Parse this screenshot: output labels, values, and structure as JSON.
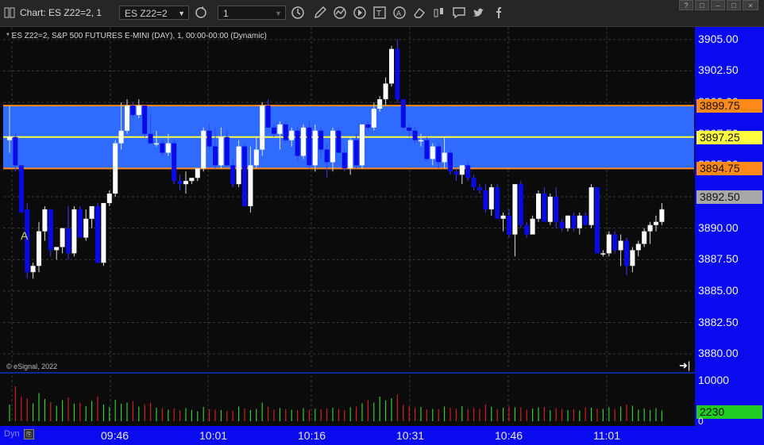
{
  "window": {
    "title": "Chart: ES Z22=2, 1",
    "symbol": "ES Z22=2",
    "interval": "1",
    "controls": [
      "?",
      "□",
      "–",
      "□",
      "×"
    ]
  },
  "toolbar_icons": [
    "refresh-icon",
    "clock-icon",
    "pencil-icon",
    "chart-icon",
    "play-icon",
    "text-icon",
    "alert-icon",
    "eraser-icon",
    "bars-icon",
    "chat-icon",
    "twitter-icon",
    "facebook-icon"
  ],
  "chart": {
    "info_line": "* ES Z22=2, S&P 500 FUTURES E-MINI (DAY), 1, 00:00-00:00 (Dynamic)",
    "copyright": "© eSignal, 2022",
    "marker_text": "A",
    "dyn_label": "Dyn",
    "up_color": "#ffffff",
    "down_color": "#0a0ae8",
    "band_color": "#2f6bff",
    "band_line_color": "#ff8a1a",
    "mid_line_color": "#ffff40"
  },
  "price_axis": {
    "labels": [
      "3905.00",
      "3902.50",
      "3900.00",
      "3897.50",
      "3895.00",
      "3892.50",
      "3890.00",
      "3887.50",
      "3885.00",
      "3882.50",
      "3880.00"
    ],
    "tags": [
      {
        "text": "3899.75",
        "value": 3899.75,
        "bg": "#ff8a1a"
      },
      {
        "text": "3897.25",
        "value": 3897.25,
        "bg": "#ffff40"
      },
      {
        "text": "3894.75",
        "value": 3894.75,
        "bg": "#ff8a1a"
      },
      {
        "text": "3892.50",
        "value": 3892.5,
        "bg": "#a8a8a8"
      }
    ]
  },
  "volume_axis": {
    "max_label": "10000",
    "min_label": "0",
    "last_tag": "2230",
    "last_tag_bg": "#22cc22"
  },
  "time_axis": {
    "labels": [
      "09:46",
      "10:01",
      "10:16",
      "10:31",
      "10:46",
      "11:01"
    ]
  },
  "chart_data": {
    "type": "candlestick",
    "ylim": [
      3878.75,
      3906.0
    ],
    "band": {
      "upper": 3899.75,
      "mid": 3897.25,
      "lower": 3894.75
    },
    "candles": [
      [
        3897.0,
        3899.75,
        3896.0,
        3897.25
      ],
      [
        3897.25,
        3897.5,
        3894.5,
        3895.0
      ],
      [
        3895.0,
        3895.0,
        3891.25,
        3891.25
      ],
      [
        3891.5,
        3892.0,
        3886.0,
        3886.5
      ],
      [
        3886.5,
        3887.25,
        3886.0,
        3887.0
      ],
      [
        3887.0,
        3890.5,
        3886.5,
        3889.75
      ],
      [
        3889.75,
        3891.75,
        3889.0,
        3891.5
      ],
      [
        3891.5,
        3891.5,
        3887.75,
        3888.25
      ],
      [
        3888.25,
        3888.5,
        3887.5,
        3888.5
      ],
      [
        3888.5,
        3890.0,
        3888.0,
        3890.0
      ],
      [
        3890.0,
        3891.75,
        3887.5,
        3888.0
      ],
      [
        3888.0,
        3891.75,
        3887.75,
        3891.5
      ],
      [
        3891.5,
        3891.75,
        3889.25,
        3889.25
      ],
      [
        3889.25,
        3891.5,
        3889.0,
        3890.75
      ],
      [
        3890.75,
        3891.5,
        3890.0,
        3891.75
      ],
      [
        3891.75,
        3892.0,
        3887.25,
        3887.25
      ],
      [
        3887.25,
        3892.0,
        3887.0,
        3892.0
      ],
      [
        3892.0,
        3893.0,
        3891.75,
        3892.75
      ],
      [
        3892.75,
        3897.0,
        3892.5,
        3896.75
      ],
      [
        3896.75,
        3900.0,
        3896.25,
        3897.75
      ],
      [
        3897.75,
        3900.25,
        3897.5,
        3899.75
      ],
      [
        3899.75,
        3900.0,
        3898.75,
        3899.0
      ],
      [
        3899.0,
        3900.25,
        3898.75,
        3899.75
      ],
      [
        3899.75,
        3899.75,
        3897.25,
        3897.5
      ],
      [
        3897.5,
        3899.0,
        3896.75,
        3896.75
      ],
      [
        3896.75,
        3897.75,
        3896.5,
        3896.75
      ],
      [
        3896.75,
        3897.0,
        3895.75,
        3896.0
      ],
      [
        3896.0,
        3897.5,
        3895.75,
        3896.75
      ],
      [
        3896.75,
        3897.0,
        3893.5,
        3893.75
      ],
      [
        3893.75,
        3894.25,
        3893.0,
        3893.5
      ],
      [
        3893.5,
        3894.5,
        3892.75,
        3893.75
      ],
      [
        3893.75,
        3894.0,
        3893.5,
        3894.0
      ],
      [
        3894.0,
        3894.75,
        3893.75,
        3894.75
      ],
      [
        3894.75,
        3898.0,
        3894.5,
        3897.75
      ],
      [
        3897.75,
        3898.25,
        3896.25,
        3896.5
      ],
      [
        3896.5,
        3898.0,
        3894.75,
        3895.0
      ],
      [
        3895.0,
        3898.0,
        3894.75,
        3897.25
      ],
      [
        3897.25,
        3897.75,
        3895.0,
        3895.0
      ],
      [
        3895.0,
        3895.5,
        3893.25,
        3893.5
      ],
      [
        3893.5,
        3897.0,
        3893.25,
        3896.5
      ],
      [
        3896.5,
        3896.75,
        3891.75,
        3891.75
      ],
      [
        3891.75,
        3896.5,
        3891.25,
        3895.0
      ],
      [
        3895.0,
        3897.25,
        3894.75,
        3896.25
      ],
      [
        3896.25,
        3900.0,
        3895.75,
        3899.75
      ],
      [
        3899.75,
        3900.25,
        3898.0,
        3898.0
      ],
      [
        3898.0,
        3898.25,
        3897.25,
        3897.5
      ],
      [
        3897.5,
        3898.5,
        3896.25,
        3898.25
      ],
      [
        3898.25,
        3898.5,
        3896.75,
        3897.0
      ],
      [
        3897.0,
        3898.0,
        3896.5,
        3897.75
      ],
      [
        3897.75,
        3898.0,
        3895.25,
        3895.75
      ],
      [
        3895.75,
        3898.25,
        3895.5,
        3898.0
      ],
      [
        3898.0,
        3898.5,
        3894.75,
        3895.0
      ],
      [
        3895.0,
        3898.25,
        3894.5,
        3897.75
      ],
      [
        3897.75,
        3898.0,
        3895.5,
        3896.25
      ],
      [
        3896.25,
        3896.75,
        3894.0,
        3895.25
      ],
      [
        3895.25,
        3898.0,
        3894.5,
        3897.75
      ],
      [
        3897.75,
        3898.0,
        3896.0,
        3896.0
      ],
      [
        3896.0,
        3896.25,
        3894.5,
        3894.75
      ],
      [
        3894.75,
        3897.25,
        3894.25,
        3897.0
      ],
      [
        3897.0,
        3897.5,
        3894.75,
        3895.0
      ],
      [
        3895.0,
        3898.25,
        3894.75,
        3898.25
      ],
      [
        3898.25,
        3898.5,
        3897.75,
        3898.0
      ],
      [
        3898.0,
        3900.0,
        3897.75,
        3899.5
      ],
      [
        3899.5,
        3900.5,
        3899.25,
        3900.25
      ],
      [
        3900.25,
        3902.0,
        3899.75,
        3901.5
      ],
      [
        3901.5,
        3904.5,
        3901.25,
        3904.25
      ],
      [
        3904.25,
        3905.0,
        3900.0,
        3900.25
      ],
      [
        3900.25,
        3900.25,
        3897.75,
        3898.0
      ],
      [
        3898.0,
        3898.25,
        3897.25,
        3897.75
      ],
      [
        3897.75,
        3898.0,
        3896.75,
        3897.0
      ],
      [
        3897.0,
        3897.5,
        3896.5,
        3897.0
      ],
      [
        3897.0,
        3897.25,
        3895.25,
        3895.5
      ],
      [
        3895.5,
        3896.75,
        3895.0,
        3896.5
      ],
      [
        3896.5,
        3896.75,
        3894.75,
        3895.25
      ],
      [
        3895.25,
        3897.25,
        3894.75,
        3896.0
      ],
      [
        3896.0,
        3896.25,
        3894.25,
        3894.5
      ],
      [
        3894.5,
        3894.75,
        3893.75,
        3894.25
      ],
      [
        3894.25,
        3895.0,
        3893.5,
        3895.0
      ],
      [
        3895.0,
        3895.25,
        3893.75,
        3894.0
      ],
      [
        3894.0,
        3894.25,
        3893.0,
        3893.25
      ],
      [
        3893.25,
        3893.5,
        3892.75,
        3893.0
      ],
      [
        3893.0,
        3893.5,
        3891.25,
        3891.5
      ],
      [
        3891.5,
        3893.5,
        3891.0,
        3893.25
      ],
      [
        3893.25,
        3893.5,
        3890.75,
        3890.75
      ],
      [
        3890.75,
        3891.25,
        3889.75,
        3891.0
      ],
      [
        3891.0,
        3891.5,
        3889.25,
        3889.5
      ],
      [
        3889.5,
        3893.5,
        3887.75,
        3893.5
      ],
      [
        3893.5,
        3893.75,
        3890.0,
        3890.25
      ],
      [
        3890.25,
        3890.5,
        3889.25,
        3889.5
      ],
      [
        3889.5,
        3891.0,
        3889.5,
        3890.75
      ],
      [
        3890.75,
        3893.0,
        3890.5,
        3892.75
      ],
      [
        3892.75,
        3893.25,
        3890.5,
        3890.5
      ],
      [
        3890.5,
        3892.75,
        3890.25,
        3892.5
      ],
      [
        3892.5,
        3893.25,
        3890.0,
        3890.5
      ],
      [
        3890.5,
        3890.75,
        3889.75,
        3890.0
      ],
      [
        3890.0,
        3891.0,
        3889.75,
        3891.0
      ],
      [
        3891.0,
        3891.25,
        3889.75,
        3890.0
      ],
      [
        3890.0,
        3891.25,
        3889.5,
        3891.0
      ],
      [
        3891.0,
        3891.25,
        3890.25,
        3890.25
      ],
      [
        3890.25,
        3893.5,
        3890.0,
        3893.25
      ],
      [
        3893.25,
        3893.25,
        3888.0,
        3888.0
      ],
      [
        3888.0,
        3888.25,
        3887.75,
        3888.0
      ],
      [
        3888.0,
        3889.75,
        3887.75,
        3889.5
      ],
      [
        3889.5,
        3889.75,
        3888.0,
        3888.25
      ],
      [
        3888.25,
        3889.5,
        3887.0,
        3889.0
      ],
      [
        3889.0,
        3889.25,
        3886.25,
        3887.0
      ],
      [
        3887.0,
        3888.5,
        3886.5,
        3888.25
      ],
      [
        3888.25,
        3889.0,
        3887.75,
        3888.75
      ],
      [
        3888.75,
        3890.0,
        3888.5,
        3889.75
      ],
      [
        3889.75,
        3890.5,
        3888.75,
        3890.25
      ],
      [
        3890.25,
        3891.0,
        3889.75,
        3890.5
      ],
      [
        3890.5,
        3892.0,
        3890.25,
        3891.5
      ]
    ],
    "volume_max": 10000,
    "volumes": [
      4200,
      8800,
      6200,
      5700,
      4500,
      7100,
      5600,
      4800,
      3900,
      5300,
      6000,
      4400,
      4700,
      3800,
      5100,
      6300,
      4200,
      3600,
      5400,
      4400,
      4700,
      5000,
      3700,
      4300,
      4700,
      3400,
      3300,
      2900,
      3200,
      2700,
      3300,
      2800,
      2500,
      3600,
      3000,
      2900,
      2800,
      2600,
      2700,
      3700,
      3200,
      2800,
      3100,
      4700,
      3600,
      2900,
      3300,
      3100,
      2900,
      2800,
      3300,
      2900,
      3100,
      3000,
      3200,
      3400,
      3100,
      2800,
      3500,
      3700,
      4500,
      5300,
      4700,
      6200,
      5200,
      5800,
      6700,
      4200,
      3800,
      3300,
      3600,
      3000,
      3100,
      3000,
      3700,
      3400,
      3200,
      3800,
      3100,
      3300,
      3100,
      4200,
      3600,
      3100,
      3400,
      3700,
      3500,
      3500,
      2900,
      3200,
      3500,
      3600,
      2800,
      3300,
      3100,
      2800,
      3000,
      2700,
      3500,
      3400,
      3200,
      3100,
      3500,
      3100,
      3700,
      4200,
      3900,
      2900,
      3200,
      2800,
      3300,
      2700
    ],
    "volume_colors": "green when candle up, red when candle down"
  }
}
